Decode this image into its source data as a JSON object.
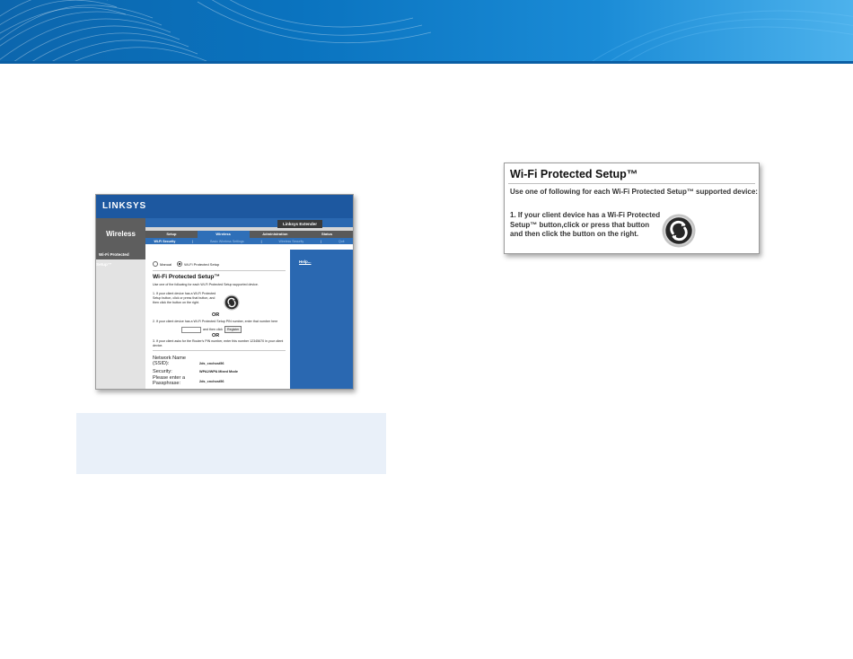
{
  "left_screenshot": {
    "logo": "LINKSYS",
    "product": "Linksys Extender",
    "section": "Wireless",
    "tabs": [
      "Setup",
      "Wireless",
      "Administration",
      "Status"
    ],
    "subtabs": [
      "Wi-Fi Security",
      "Basic Wireless Settings",
      "Wireless Security",
      "Quit"
    ],
    "side_label": "Wi-Fi Protected Setup™",
    "help_link": "Help...",
    "radio_manual": "Manual",
    "radio_wps": "Wi-Fi Protected Setup",
    "title": "Wi-Fi Protected Setup™",
    "intro": "Use one of the following for each Wi-Fi Protected Setup supported device.",
    "step1": "1. If your client device has a Wi-Fi Protected Setup button, click or press that button, and then click the button on the right.",
    "or_label": "OR",
    "step2": "2. If your client device has a Wi-Fi Protected Setup PIN number, enter that number here",
    "step2_suffix": "and then click",
    "register_label": "Register",
    "step3": "3. If your client asks for the Router's PIN number, enter this number 12345670 in your client device.",
    "network_name_label": "Network Name (SSID):",
    "network_name_value": "2ds_cnchost56",
    "security_label": "Security:",
    "security_value": "WPA2/WPA Mixed Mode",
    "passphrase_label": "Please enter a Passphrase:",
    "passphrase_value": "2ds_cnchost56"
  },
  "right_screenshot": {
    "title": "Wi-Fi Protected Setup™",
    "intro": "Use one of following for each Wi-Fi Protected Setup™ supported device:",
    "step1": "1. If your client device has a Wi-Fi Protected Setup™ button,click or press that button and then click the button on the right."
  },
  "colors": {
    "banner_blue": "#0a73bf",
    "router_blue": "#1d58a0",
    "note_box": "#e9f0f9"
  },
  "icons": [
    "wps-icon"
  ]
}
